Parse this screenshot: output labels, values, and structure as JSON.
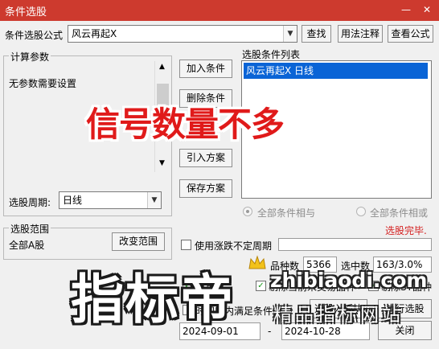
{
  "window": {
    "title": "条件选股"
  },
  "formula": {
    "label": "条件选股公式",
    "value": "风云再起X",
    "btn_find": "查找",
    "btn_usage": "用法注释",
    "btn_view": "查看公式"
  },
  "params": {
    "group_title": "计算参数",
    "message": "无参数需要设置"
  },
  "period": {
    "label": "选股周期:",
    "value": "日线"
  },
  "middle_buttons": {
    "add": "加入条件",
    "delete": "删除条件",
    "import": "引入方案",
    "save": "保存方案"
  },
  "conditions": {
    "header": "选股条件列表",
    "items": [
      "风云再起X  日线"
    ]
  },
  "logic": {
    "and_label": "全部条件相与",
    "or_label": "全部条件相或"
  },
  "status": {
    "text": "选股完毕.",
    "color": "#d42020"
  },
  "scope": {
    "group_title": "选股范围",
    "value": "全部A股",
    "change_btn": "改变范围"
  },
  "uncertain_period": {
    "label": "使用涨跌不定周期"
  },
  "counts": {
    "variety_label": "品种数",
    "variety_value": "5366",
    "selected_label": "选中数",
    "selected_value": "163/3.0%"
  },
  "options": {
    "pre_adjust": "前复权",
    "exclude_cut": "剔除当前未交易品种",
    "exclude_st": "剔除ST品种"
  },
  "time_range": {
    "label": "时间段内满足条件",
    "start": "2024-09-01",
    "dash": "-",
    "end": "2024-10-28"
  },
  "bottom_buttons": {
    "select_to_board": "选股入板块",
    "execute": "执行选股",
    "close": "关闭"
  },
  "overlays": {
    "red_caption": "信号数量不多",
    "big_watermark": "指标帝",
    "url": "zhibiaodi.com",
    "sub": "精品指标网站"
  }
}
